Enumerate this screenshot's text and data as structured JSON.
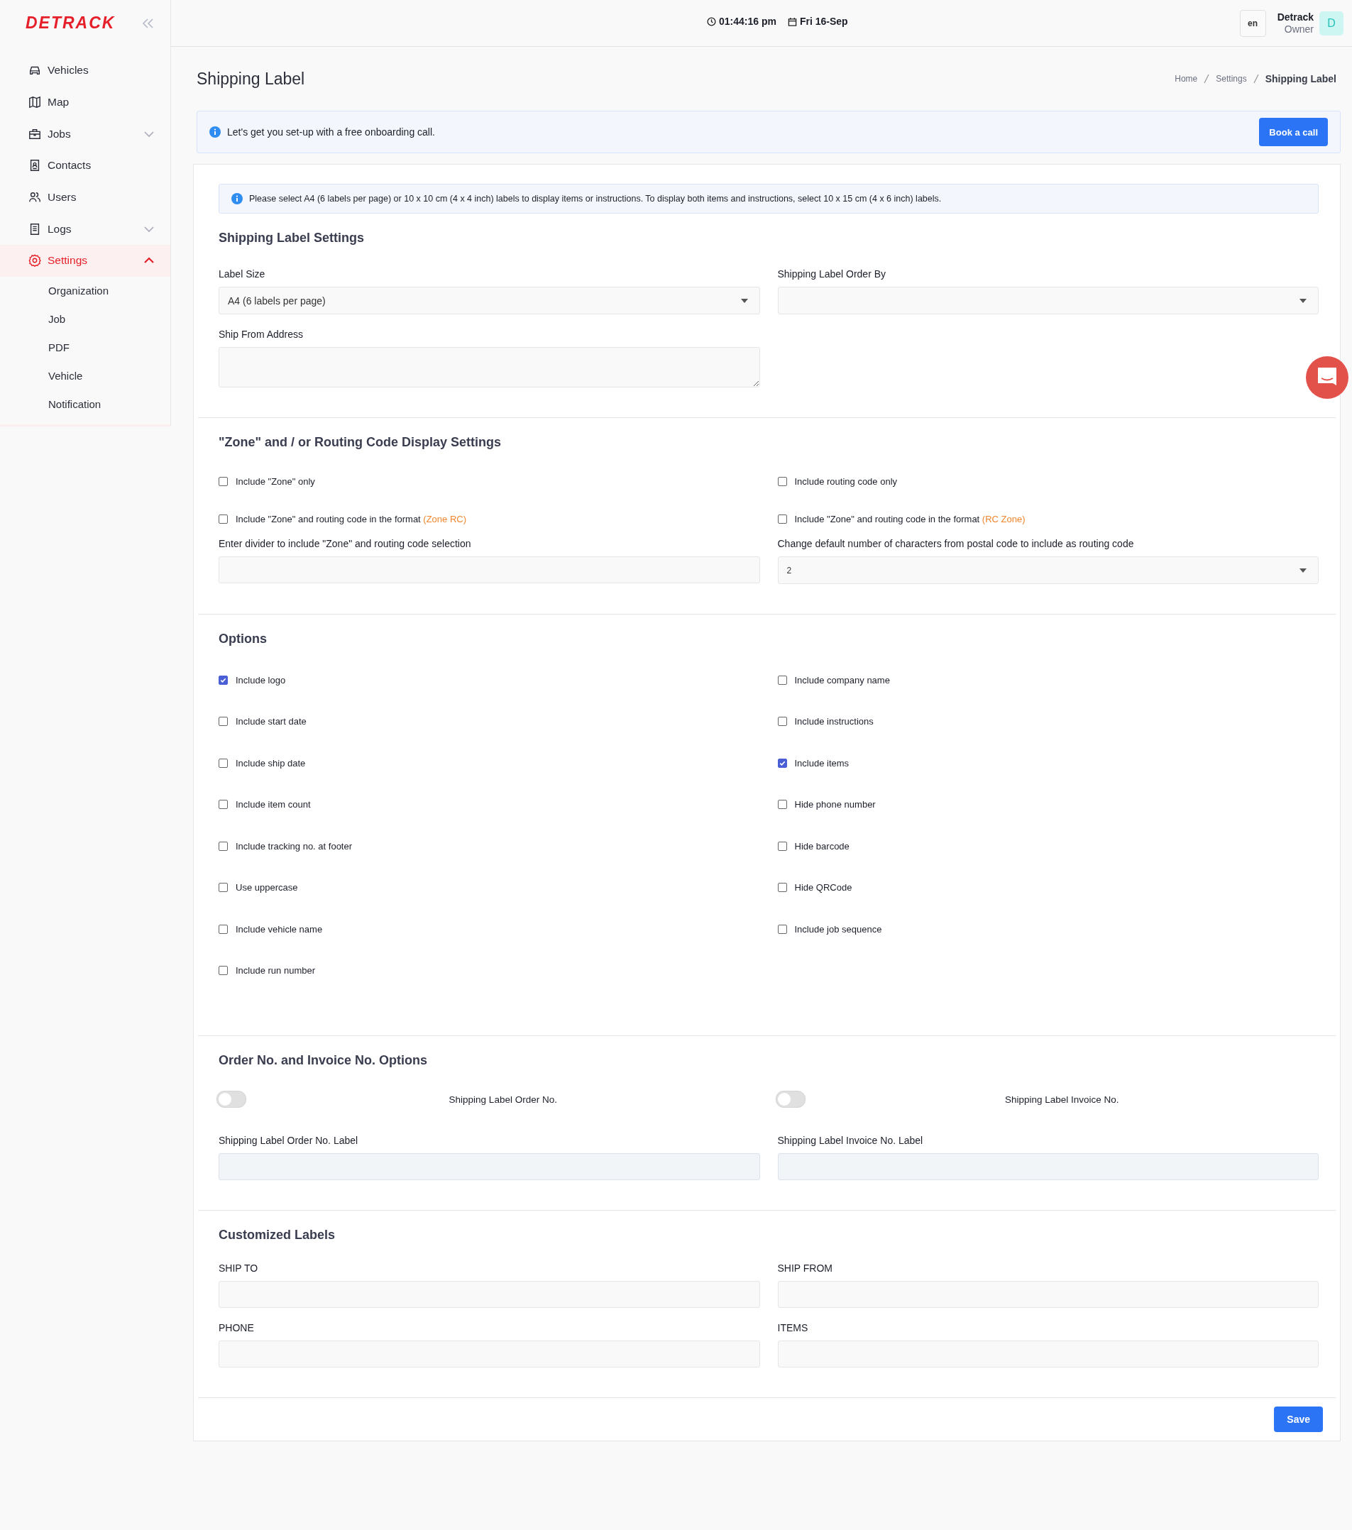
{
  "logo": "DETRACK",
  "sidebar": {
    "items": [
      {
        "label": "Vehicles",
        "kind": "car",
        "selected": false
      },
      {
        "label": "Map",
        "kind": "map",
        "selected": false
      },
      {
        "label": "Jobs",
        "kind": "briefcase",
        "selected": false,
        "expanded": false
      },
      {
        "label": "Contacts",
        "kind": "contact",
        "selected": false
      },
      {
        "label": "Users",
        "kind": "users",
        "selected": false
      },
      {
        "label": "Logs",
        "kind": "list",
        "selected": false,
        "expanded": false
      },
      {
        "label": "Settings",
        "kind": "gear",
        "selected": true,
        "expanded": true,
        "children": [
          {
            "label": "Organization"
          },
          {
            "label": "Job"
          },
          {
            "label": "PDF"
          },
          {
            "label": "Vehicle"
          },
          {
            "label": "Notification"
          }
        ]
      }
    ]
  },
  "topbar": {
    "time": "01:44:16 pm",
    "date": "Fri 16-Sep",
    "language": "en",
    "user_name": "Detrack",
    "user_role": "Owner",
    "avatar": "D"
  },
  "page_title": "Shipping Label",
  "breadcrumbs": [
    "Home",
    "Settings",
    "Shipping Label"
  ],
  "banner": {
    "text": "Let's get you set-up with a free onboarding call.",
    "button": "Book a call"
  },
  "notice": "Please select A4 (6 labels per page) or 10 x 10 cm (4 x 4 inch) labels to display items or instructions. To display both items and instructions, select 10 x 15 cm (4 x 6 inch) labels.",
  "label_settings": {
    "title": "Shipping Label Settings",
    "label_size": {
      "label": "Label Size",
      "value": "A4 (6 labels per page)"
    },
    "order_by": {
      "label": "Shipping Label Order By"
    },
    "ship_from": {
      "label": "Ship From Address"
    }
  },
  "zone_settings": {
    "title": "\"Zone\" and / or Routing Code Display Settings",
    "checkboxes": [
      {
        "label": "Include \"Zone\" only",
        "checked": false
      },
      {
        "label": "Include routing code only",
        "checked": false
      },
      {
        "label": "Include \"Zone\" and routing code in the format",
        "format": "(Zone RC)",
        "checked": false
      },
      {
        "label": "Include \"Zone\" and routing code in the format",
        "format": "(RC Zone)",
        "checked": false
      }
    ],
    "divider_field": {
      "label": "Enter divider to include \"Zone\" and routing code selection"
    },
    "characters_field": {
      "label": "Change default number of characters from postal code to include as routing code",
      "value": "2"
    }
  },
  "options": {
    "title": "Options",
    "left": [
      {
        "label": "Include logo",
        "checked": true
      },
      {
        "label": "Include start date",
        "checked": false
      },
      {
        "label": "Include ship date",
        "checked": false
      },
      {
        "label": "Include item count",
        "checked": false
      },
      {
        "label": "Include tracking no. at footer",
        "checked": false
      },
      {
        "label": "Use uppercase",
        "checked": false
      },
      {
        "label": "Include vehicle name",
        "checked": false
      },
      {
        "label": "Include run number",
        "checked": false
      }
    ],
    "right": [
      {
        "label": "Include company name",
        "checked": false
      },
      {
        "label": "Include instructions",
        "checked": false
      },
      {
        "label": "Include items",
        "checked": true
      },
      {
        "label": "Hide phone number",
        "checked": false
      },
      {
        "label": "Hide barcode",
        "checked": false
      },
      {
        "label": "Hide QRCode",
        "checked": false
      },
      {
        "label": "Include job sequence",
        "checked": false
      }
    ]
  },
  "number_options": {
    "title": "Order No. and Invoice No. Options",
    "toggles": [
      {
        "label": "Shipping Label Order No.",
        "on": false
      },
      {
        "label": "Shipping Label Invoice No.",
        "on": false
      }
    ],
    "fields": [
      {
        "label": "Shipping Label Order No. Label"
      },
      {
        "label": "Shipping Label Invoice No. Label"
      }
    ]
  },
  "customized_labels": {
    "title": "Customized Labels",
    "fields": [
      {
        "label": "SHIP TO"
      },
      {
        "label": "SHIP FROM"
      },
      {
        "label": "PHONE"
      },
      {
        "label": "ITEMS"
      }
    ]
  },
  "save_button": "Save"
}
